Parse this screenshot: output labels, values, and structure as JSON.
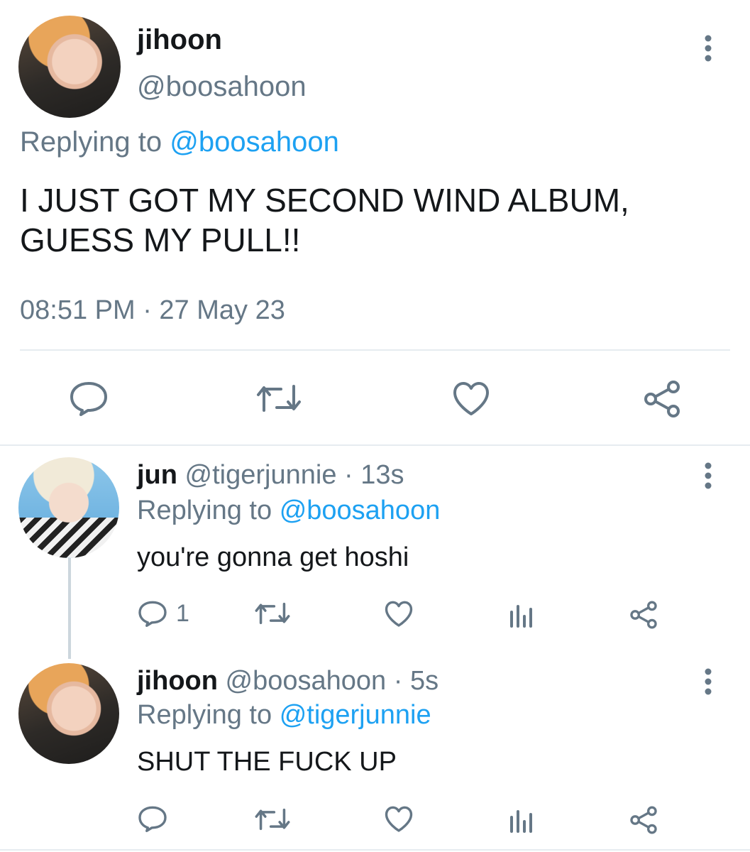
{
  "main_tweet": {
    "display_name": "jihoon",
    "handle": "@boosahoon",
    "replying_prefix": "Replying to",
    "replying_to": "@boosahoon",
    "text_line1": "I JUST GOT MY SECOND WIND ALBUM,",
    "text_line2": "GUESS MY PULL!!",
    "timestamp": "08:51 PM · 27 May 23"
  },
  "reply1": {
    "display_name": "jun",
    "handle": "@tigerjunnie",
    "time": "· 13s",
    "replying_prefix": "Replying to",
    "replying_to": "@boosahoon",
    "text": "you're gonna get hoshi",
    "reply_count": "1"
  },
  "reply2": {
    "display_name": "jihoon",
    "handle": "@boosahoon",
    "time": "· 5s",
    "replying_prefix": "Replying to",
    "replying_to": "@tigerjunnie",
    "text": "SHUT THE FUCK UP"
  },
  "icons": [
    "more-icon",
    "reply-icon",
    "retweet-icon",
    "like-icon",
    "share-icon",
    "analytics-icon"
  ],
  "colors": {
    "link": "#1da1f2",
    "secondary": "#657786",
    "icon": "#657786",
    "divider": "#e6ecf0"
  }
}
